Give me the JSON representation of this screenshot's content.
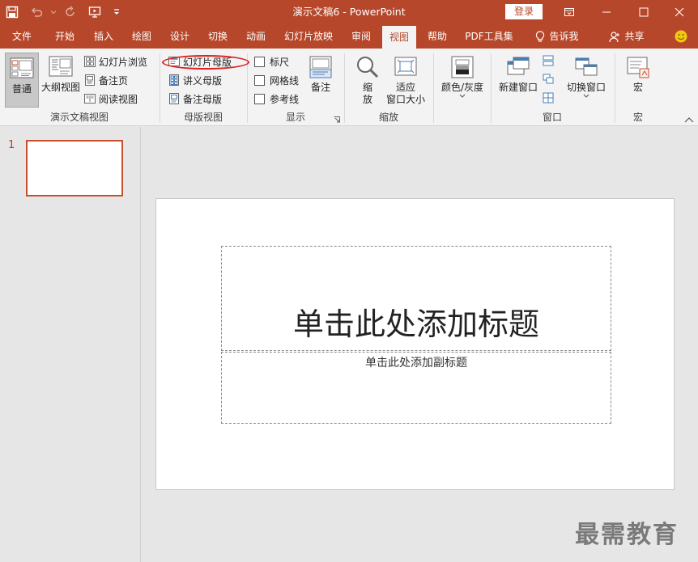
{
  "window": {
    "title": "演示文稿6  -  PowerPoint",
    "login_label": "登录"
  },
  "tabs": [
    {
      "label": "文件"
    },
    {
      "label": "开始"
    },
    {
      "label": "插入"
    },
    {
      "label": "绘图"
    },
    {
      "label": "设计"
    },
    {
      "label": "切换"
    },
    {
      "label": "动画"
    },
    {
      "label": "幻灯片放映"
    },
    {
      "label": "审阅"
    },
    {
      "label": "视图"
    },
    {
      "label": "帮助"
    },
    {
      "label": "PDF工具集"
    },
    {
      "label": "告诉我"
    },
    {
      "label": "共享"
    }
  ],
  "ribbon": {
    "presentation_views": {
      "label": "演示文稿视图",
      "normal": "普通",
      "outline": "大纲视图",
      "slide_sorter": "幻灯片浏览",
      "notes_page": "备注页",
      "reading_view": "阅读视图"
    },
    "master_views": {
      "label": "母版视图",
      "slide_master": "幻灯片母版",
      "handout_master": "讲义母版",
      "notes_master": "备注母版"
    },
    "show": {
      "label": "显示",
      "ruler": "标尺",
      "gridlines": "网格线",
      "guides": "参考线",
      "notes": "备注"
    },
    "zoom": {
      "label": "缩放",
      "zoom_line1": "缩",
      "zoom_line2": "放",
      "fit_line1": "适应",
      "fit_line2": "窗口大小"
    },
    "color": {
      "label": "颜色/灰度"
    },
    "window": {
      "label": "窗口",
      "new_window": "新建窗口",
      "switch_windows": "切换窗口"
    },
    "macros": {
      "label": "宏",
      "macros_button": "宏"
    }
  },
  "thumbnails": [
    {
      "number": "1"
    }
  ],
  "slide": {
    "title_placeholder": "单击此处添加标题",
    "subtitle_placeholder": "单击此处添加副标题"
  },
  "watermark": "最需教育",
  "colors": {
    "accent": "#b7472a",
    "ribbon_bg": "#f3f3f3",
    "highlight": "#e02020"
  }
}
